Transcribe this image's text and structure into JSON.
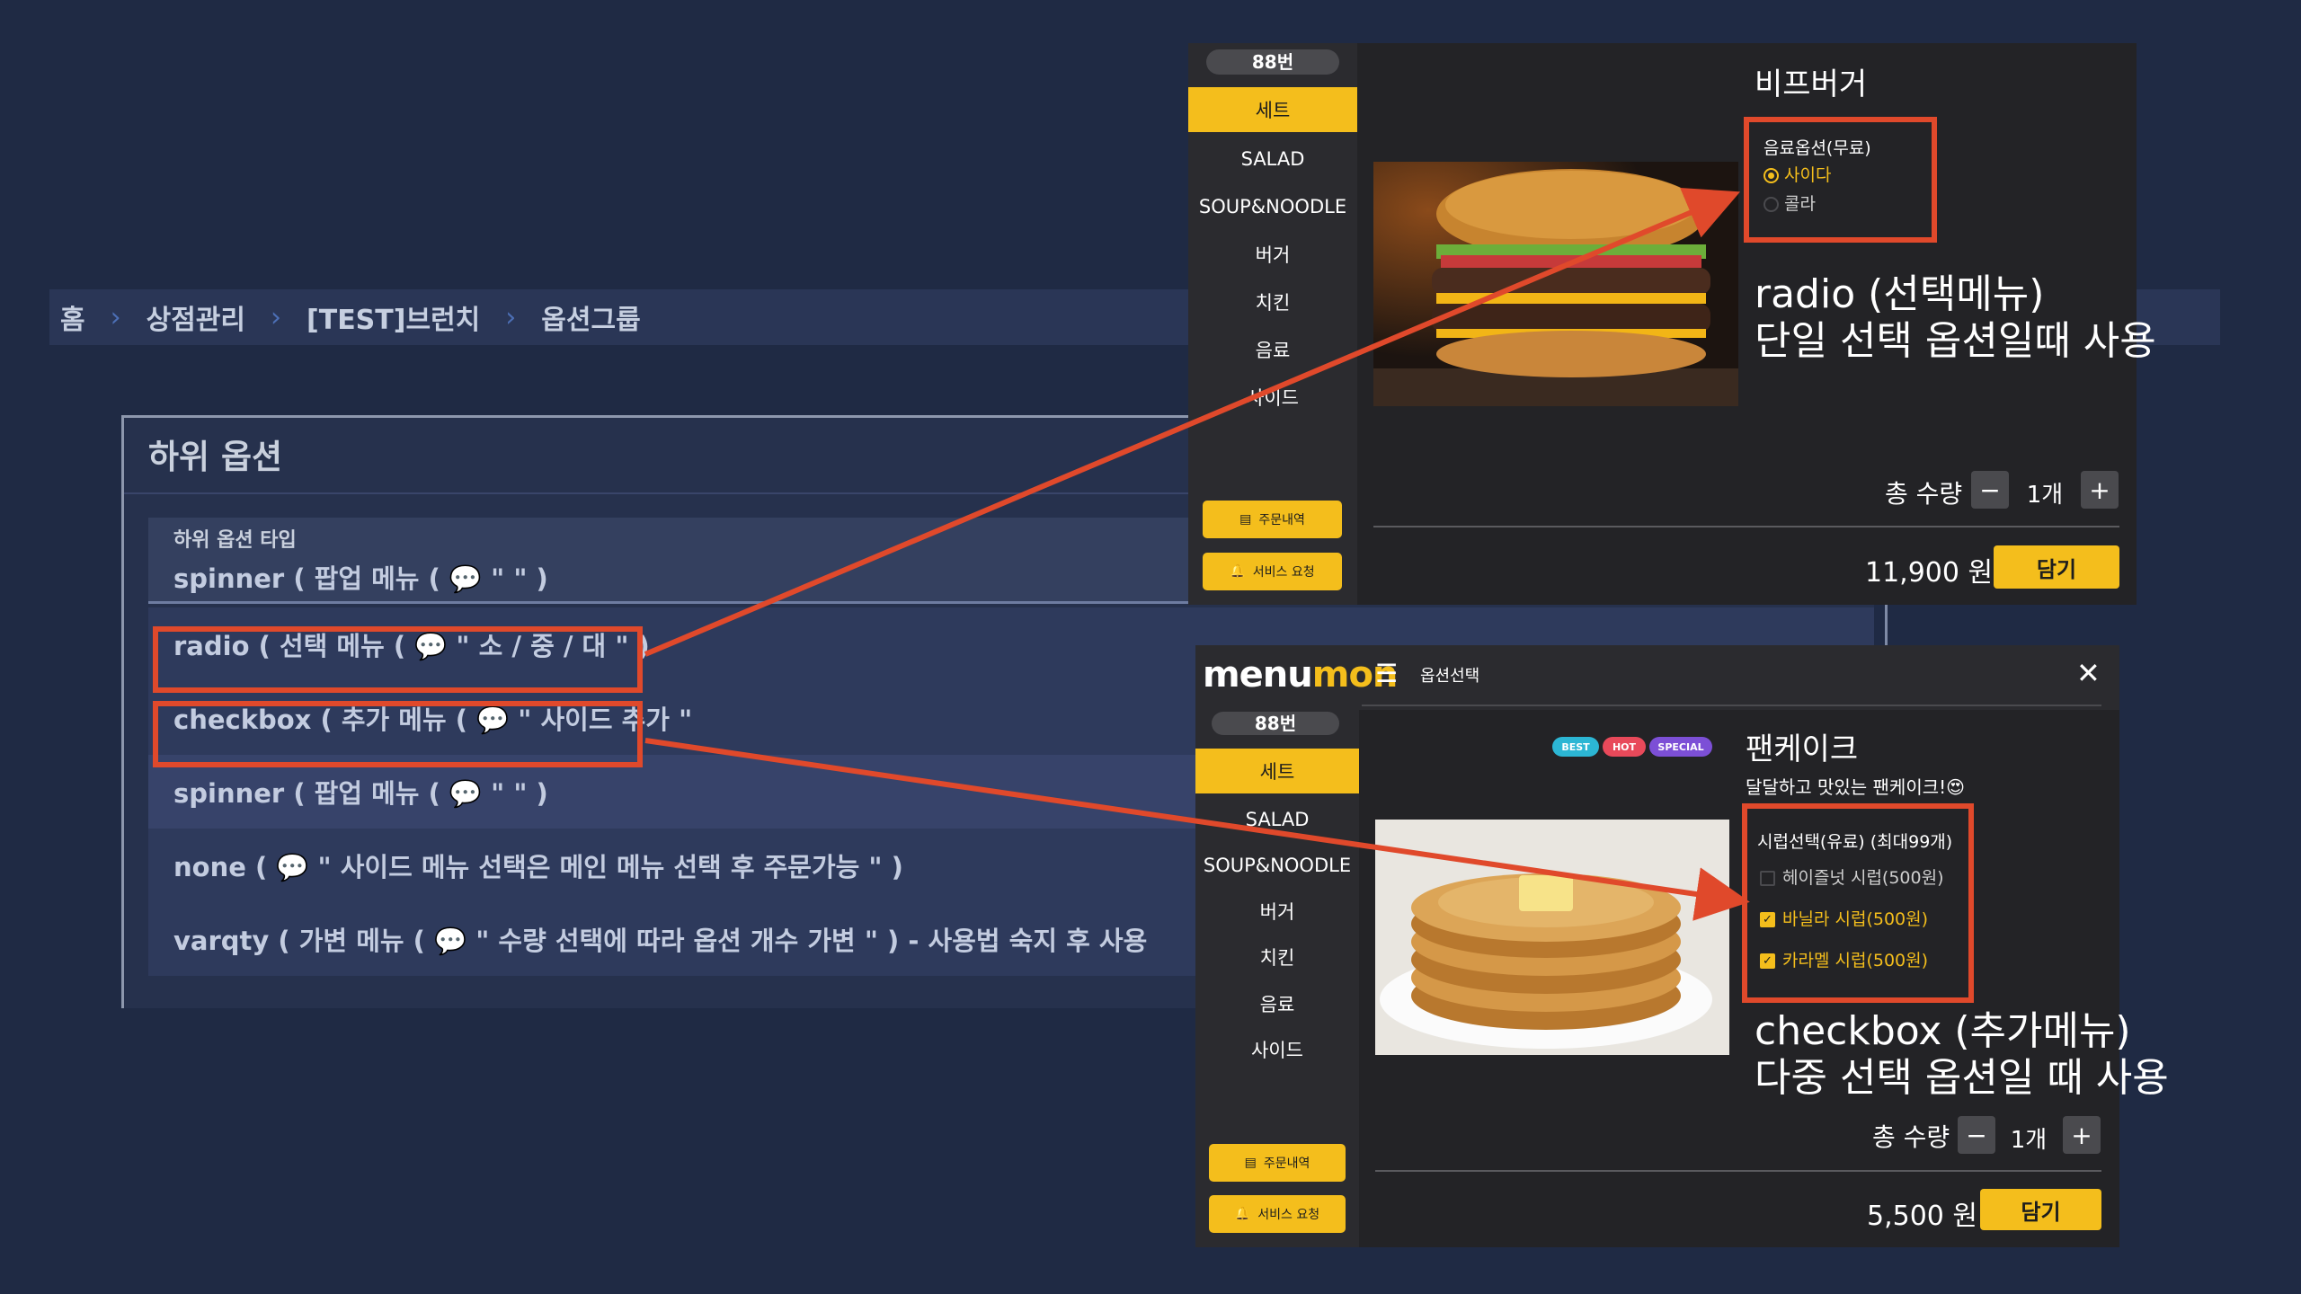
{
  "breadcrumb": [
    "홈",
    "상점관리",
    "[TEST]브런치",
    "옵션그룹"
  ],
  "subOptions": {
    "title": "하위 옵션",
    "typeLabel": "하위 옵션 타입",
    "typeValue": "spinner ( 팝업 메뉴 ( 💬 \" \" )",
    "rows": [
      "radio ( 선택 메뉴 ( 💬 \" 소 / 중 / 대 \" )",
      "checkbox ( 추가 메뉴 ( 💬 \" 사이드 추가 \"",
      "spinner ( 팝업 메뉴 ( 💬 \" \" )",
      "none ( 💬 \" 사이드 메뉴 선택은 메인 메뉴 선택 후 주문가능 \" )",
      "varqty ( 가변 메뉴 ( 💬 \" 수량 선택에 따라 옵션 개수 가변 \" ) - 사용법 숙지 후 사용"
    ]
  },
  "kioskTop": {
    "table": "88번",
    "categories": [
      "세트",
      "SALAD",
      "SOUP&NOODLE",
      "버거",
      "치킨",
      "음료",
      "사이드"
    ],
    "orderHistory": "주문내역",
    "serviceRequest": "서비스 요청",
    "itemName": "비프버거",
    "optionGroup": "음료옵션(무료)",
    "options": [
      {
        "label": "사이다",
        "selected": true
      },
      {
        "label": "콜라",
        "selected": false
      }
    ],
    "qtyLabel": "총 수량",
    "qty": "1개",
    "price": "11,900 원",
    "addLabel": "담기",
    "annotation": [
      "radio (선택메뉴)",
      "단일 선택 옵션일때 사용"
    ]
  },
  "kioskBottom": {
    "logo_a": "menu",
    "logo_b": "mon",
    "headerTitle": "옵션선택",
    "table": "88번",
    "categories": [
      "세트",
      "SALAD",
      "SOUP&NOODLE",
      "버거",
      "치킨",
      "음료",
      "사이드"
    ],
    "orderHistory": "주문내역",
    "serviceRequest": "서비스 요청",
    "tags": [
      {
        "label": "BEST",
        "color": "#2cb6d4"
      },
      {
        "label": "HOT",
        "color": "#e8495a"
      },
      {
        "label": "SPECIAL",
        "color": "#7c4fd6"
      }
    ],
    "itemName": "팬케이크",
    "itemDesc": "달달하고 맛있는 팬케이크!😍",
    "optionGroup": "시럽선택(유료) (최대99개)",
    "options": [
      {
        "label": "헤이즐넛 시럽(500원)",
        "checked": false
      },
      {
        "label": "바닐라 시럽(500원)",
        "checked": true
      },
      {
        "label": "카라멜 시럽(500원)",
        "checked": true
      }
    ],
    "qtyLabel": "총 수량",
    "qty": "1개",
    "price": "5,500 원",
    "addLabel": "담기",
    "annotation": [
      "checkbox (추가메뉴)",
      "다중 선택 옵션일 때 사용"
    ]
  },
  "colors": {
    "background": "#1f2a44",
    "accent": "#f4be1c",
    "highlight": "#e0492b"
  }
}
